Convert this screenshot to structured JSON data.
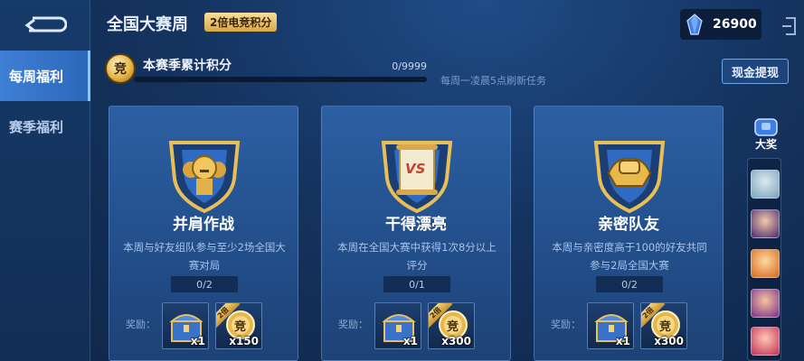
{
  "header": {
    "title": "全国大赛周",
    "badge": "2倍电竞积分",
    "currency_value": "26900"
  },
  "sidebar": {
    "items": [
      {
        "label": "每周福利",
        "active": true
      },
      {
        "label": "赛季福利",
        "active": false
      }
    ]
  },
  "season": {
    "icon_glyph": "竞",
    "title": "本赛季累计积分",
    "count": "0/9999",
    "progress": 0,
    "refresh_note": "每周一凌晨5点刷新任务",
    "withdraw_label": "现金提现"
  },
  "cards": [
    {
      "title": "并肩作战",
      "desc": "本周与好友组队参与至少2场全国大赛对局",
      "progress": "0/2",
      "reward_label": "奖励：",
      "rewards": [
        {
          "icon": "chest-icon",
          "qty": "x1"
        },
        {
          "icon": "points-coin-icon",
          "tag": "2倍",
          "glyph": "竞",
          "qty": "x150"
        }
      ]
    },
    {
      "title": "干得漂亮",
      "desc": "本周在全国大赛中获得1次8分以上评分",
      "emblem_text": "VS",
      "progress": "0/1",
      "reward_label": "奖励：",
      "rewards": [
        {
          "icon": "chest-icon",
          "qty": "x1"
        },
        {
          "icon": "points-coin-icon",
          "tag": "2倍",
          "glyph": "竞",
          "qty": "x300"
        }
      ]
    },
    {
      "title": "亲密队友",
      "desc": "本周与亲密度高于100的好友共同参与2局全国大赛",
      "progress": "0/2",
      "reward_label": "奖励：",
      "rewards": [
        {
          "icon": "chest-icon",
          "qty": "x1"
        },
        {
          "icon": "points-coin-icon",
          "tag": "2倍",
          "glyph": "竞",
          "qty": "x300"
        }
      ]
    }
  ],
  "rail": {
    "grand_prize_label": "大奖",
    "avatars": [
      "astronaut-avatar",
      "mage-avatar",
      "fox-avatar",
      "warrior-avatar",
      "girl-avatar"
    ]
  },
  "colors": {
    "accent_gold": "#e4b54b",
    "active_tab": "#3e80d6",
    "card_blue": "#2c5fa3"
  }
}
